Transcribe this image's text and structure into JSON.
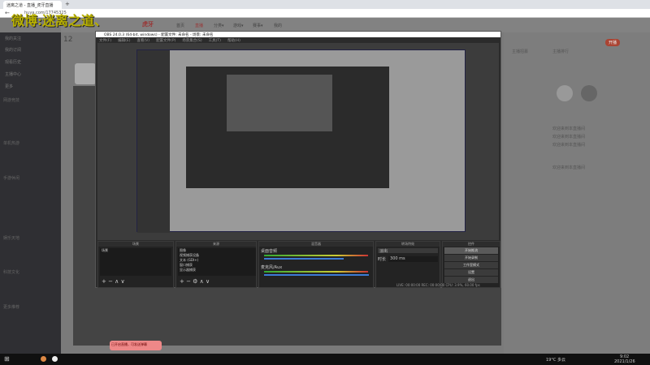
{
  "browser": {
    "tab_title": "迷离之道 - 直播_虎牙直播",
    "new_tab": "+",
    "url": "huya.com/17745325"
  },
  "watermark": "微博:迷离之道、",
  "site": {
    "nav": [
      "首页",
      "直播",
      "分类▾",
      "游戏▾",
      "赛事▾",
      "我的"
    ],
    "follow_count": "12",
    "sidebar_top": [
      "我的关注",
      "我的订阅",
      "观看历史",
      "主播中心",
      "更多"
    ],
    "sidebar_categories": [
      "网游竞技",
      "单机热游",
      "手游休闲",
      "娱乐天地",
      "科技文化",
      "更多推荐"
    ],
    "right_links": [
      "主播招募",
      "主播排行",
      "开播"
    ],
    "chat": [
      "欢迎来到本直播间",
      "欢迎来到本直播间",
      "欢迎来到本直播间",
      "欢迎来到本直播间"
    ]
  },
  "obs": {
    "title": "OBS 24.0.3 (64-bit, windows) - 配置文件: 未命名 - 场景: 未命名",
    "menu": [
      "文件(F)",
      "编辑(E)",
      "查看(V)",
      "配置文件(P)",
      "场景集合(S)",
      "工具(T)",
      "帮助(H)"
    ],
    "docks": {
      "scenes": "场景",
      "sources": "来源",
      "mixer": "混音器",
      "transitions": "转场特效",
      "controls": "控件"
    },
    "scenes": [
      "场景"
    ],
    "sources": [
      "图像",
      "视频捕获设备",
      "文本 (GDI+)",
      "窗口捕获",
      "显示器捕获"
    ],
    "mixer": [
      {
        "name": "桌面音频",
        "level": 0.72
      },
      {
        "name": "麦克风/Aux",
        "level": 0.95
      }
    ],
    "transition": "淡出",
    "duration_label": "时长",
    "duration": "300 ms",
    "controls": [
      "开始推流",
      "开始录制",
      "工作室模式",
      "设置",
      "退出"
    ],
    "status": "LIVE: 00:00:00   REC: 00:00:00   CPU: 3.9%, 60.00 fps"
  },
  "popup": "已开启直播，可发送弹幕",
  "taskbar": {
    "weather": "19°C 多云",
    "time": "9:02",
    "date": "2021/1/26"
  }
}
